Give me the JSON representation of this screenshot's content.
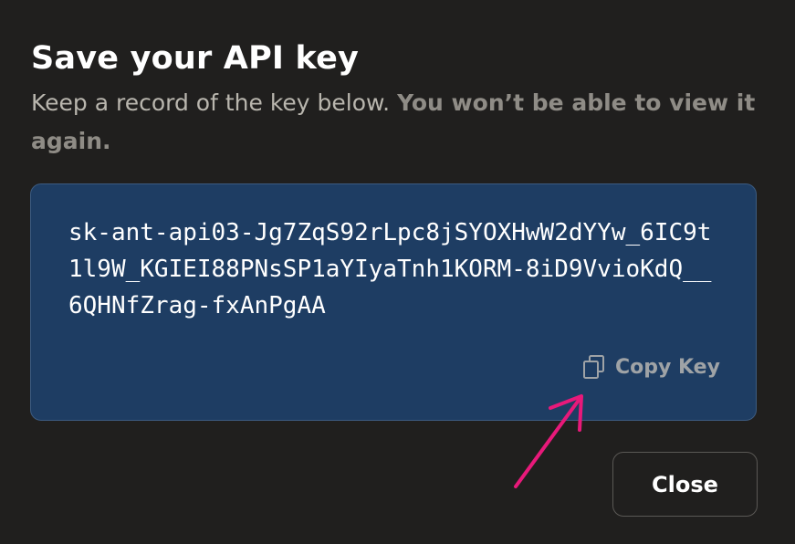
{
  "dialog": {
    "title": "Save your API key",
    "subtitle_plain": "Keep a record of the key below. ",
    "subtitle_strong": "You won’t be able to view it again.",
    "api_key": "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",
    "copy_label": "Copy Key",
    "copy_icon": "copy-icon",
    "close_label": "Close"
  },
  "annotation": {
    "arrow_icon": "pointer-arrow",
    "arrow_color": "#e8197a"
  },
  "colors": {
    "background": "#201f1e",
    "key_box_background": "#1e3d63",
    "title": "#ffffff",
    "subtitle": "#b9b6ae",
    "subtitle_strong": "#8f8c86",
    "copy_label": "#9fa3a6"
  }
}
